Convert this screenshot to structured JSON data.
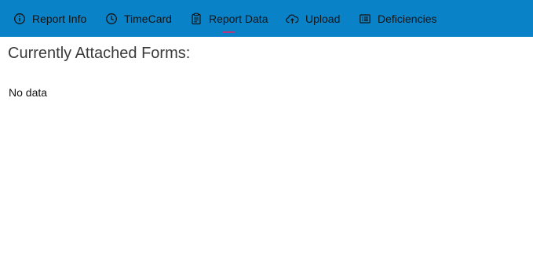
{
  "nav": {
    "tabs": [
      {
        "label": "Report Info",
        "icon": "info-icon"
      },
      {
        "label": "TimeCard",
        "icon": "clock-icon"
      },
      {
        "label": "Report Data",
        "icon": "clipboard-icon",
        "selected": true
      },
      {
        "label": "Upload",
        "icon": "cloud-upload-icon"
      },
      {
        "label": "Deficiencies",
        "icon": "list-icon"
      }
    ],
    "bar_color": "#0a82c8",
    "selected_indicator_color": "#b23a7a"
  },
  "main": {
    "title": "Currently Attached Forms:",
    "empty_message": "No data"
  }
}
